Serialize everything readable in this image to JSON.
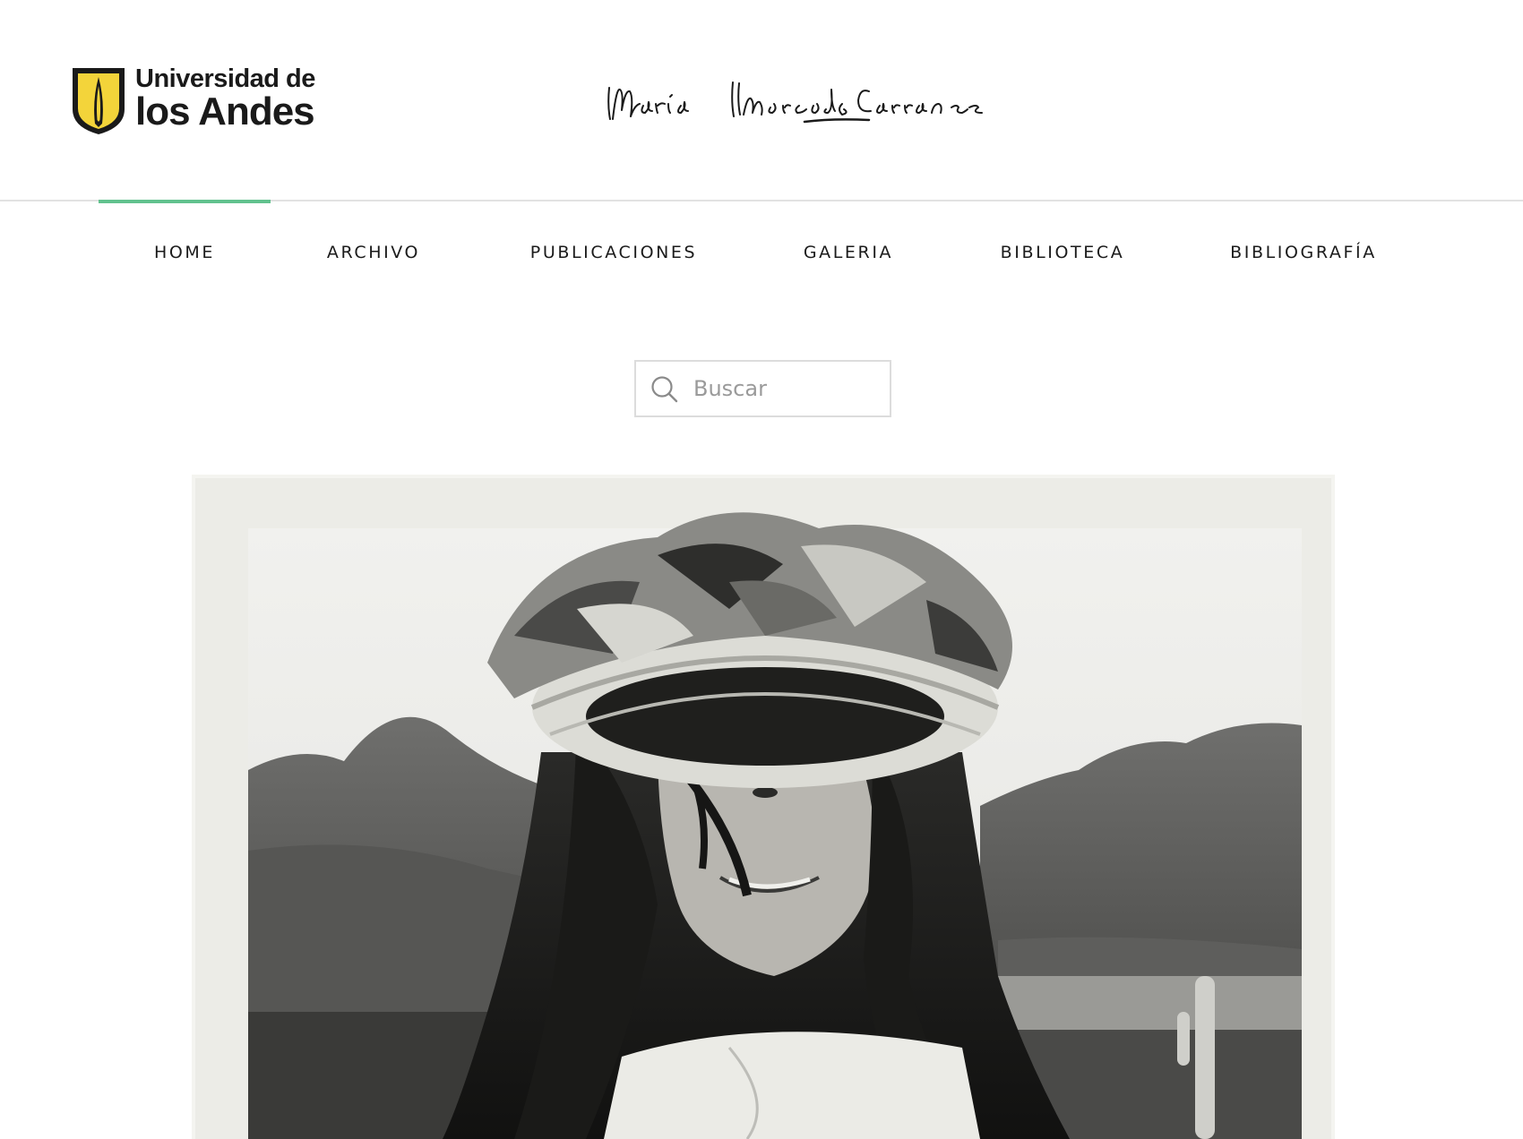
{
  "header": {
    "logo": {
      "line1": "Universidad de",
      "line2": "los Andes",
      "shield_color": "#f3d43a"
    },
    "signature_text": "María Mercedes Carranza"
  },
  "nav": {
    "accent_color": "#62c28e",
    "items": [
      {
        "label": "HOME",
        "active": true
      },
      {
        "label": "ARCHIVO",
        "active": false
      },
      {
        "label": "PUBLICACIONES",
        "active": false
      },
      {
        "label": "GALERIA",
        "active": false
      },
      {
        "label": "BIBLIOTECA",
        "active": false
      },
      {
        "label": "BIBLIOGRAFÍA",
        "active": false
      }
    ]
  },
  "search": {
    "placeholder": "Buscar",
    "value": "",
    "icon": "search-icon"
  },
  "hero": {
    "image": "black-and-white-photo-woman-straw-hat-mountains"
  }
}
